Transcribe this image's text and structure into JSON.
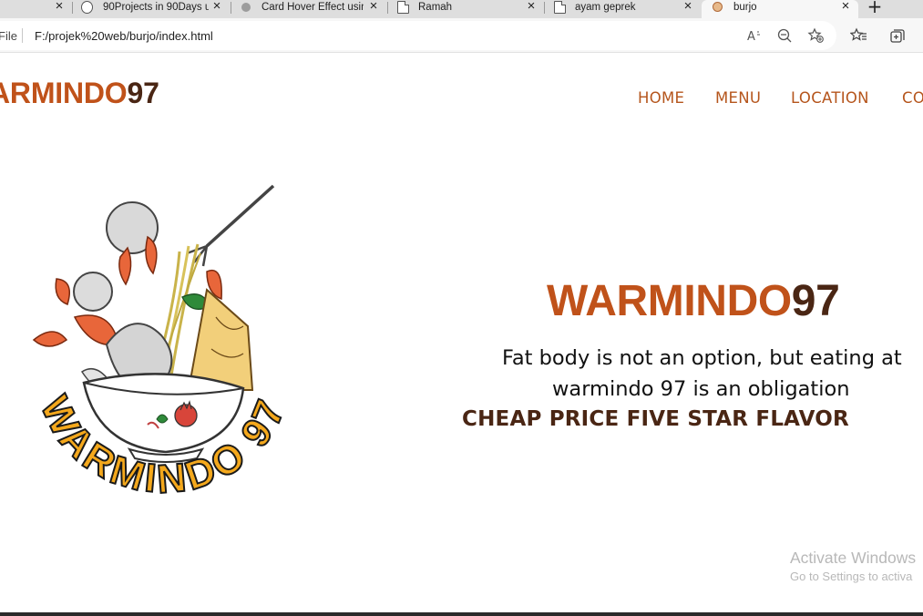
{
  "browser": {
    "tabs": [
      {
        "title": "",
        "active": false
      },
      {
        "title": "90Projects in 90Days u",
        "active": false
      },
      {
        "title": "Card Hover Effect usin",
        "active": false
      },
      {
        "title": "Ramah",
        "active": false
      },
      {
        "title": "ayam geprek",
        "active": false
      },
      {
        "title": "burjo",
        "active": true
      }
    ],
    "new_tab_symbol": "+",
    "close_symbol": "×",
    "address_scheme_label": "File",
    "url": "F:/projek%20web/burjo/index.html",
    "toolbar_icons": [
      "read-aloud-icon",
      "zoom-out-icon",
      "add-favorite-icon",
      "favorites-icon",
      "collections-icon"
    ]
  },
  "site": {
    "brand": {
      "part1": "ARMINDO",
      "part2": "97"
    },
    "nav": [
      "HOME",
      "MENU",
      "LOCATION",
      "CO"
    ],
    "logo_text": "WARMINDO 97",
    "hero": {
      "title_part1": "WARMINDO",
      "title_part2": "97",
      "line1": "Fat body is not an option, but eating at",
      "line2": "warmindo 97 is an obligation",
      "tagline": "CHEAP PRICE FIVE STAR FLAVOR"
    }
  },
  "windows_watermark": {
    "line1": "Activate Windows",
    "line2": "Go to Settings to activa"
  },
  "colors": {
    "brand_orange": "#c0521a",
    "brand_brown": "#4a2614",
    "nav_orange": "#b5551c",
    "logo_yellow": "#f4a81c"
  }
}
